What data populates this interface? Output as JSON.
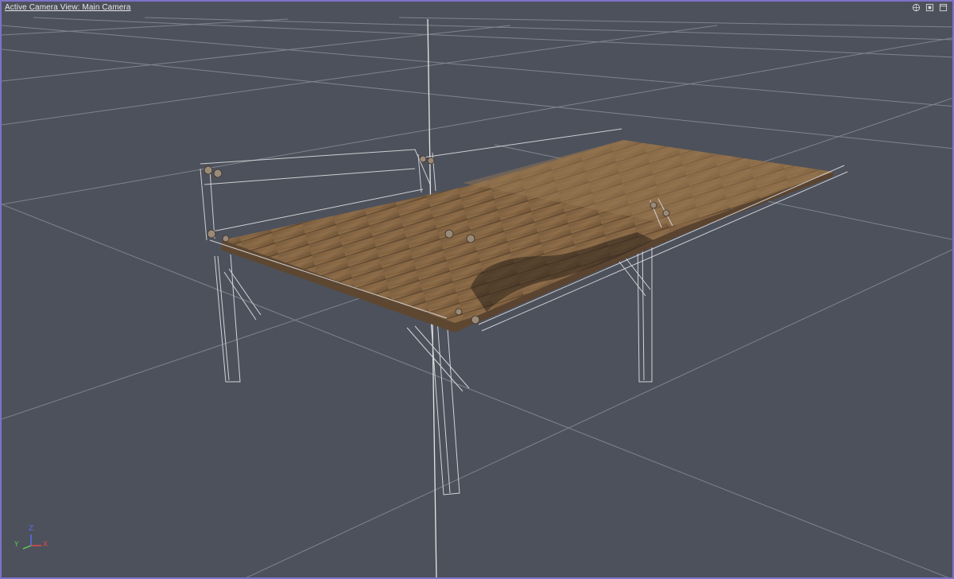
{
  "viewport": {
    "camera_label": "Active Camera View: Main Camera",
    "background": "#4d515b",
    "border_color": "#7d72c9",
    "icons": [
      "camera-rotate-icon",
      "fit-view-icon",
      "maximize-icon"
    ]
  },
  "axis_gizmo": {
    "x_label": "X",
    "y_label": "Y",
    "z_label": "Z",
    "x_color": "#e04a4a",
    "y_color": "#58c35a",
    "z_color": "#5b6ef0"
  },
  "scene": {
    "object": "wooden table",
    "texture_color": "#8a6a46"
  }
}
